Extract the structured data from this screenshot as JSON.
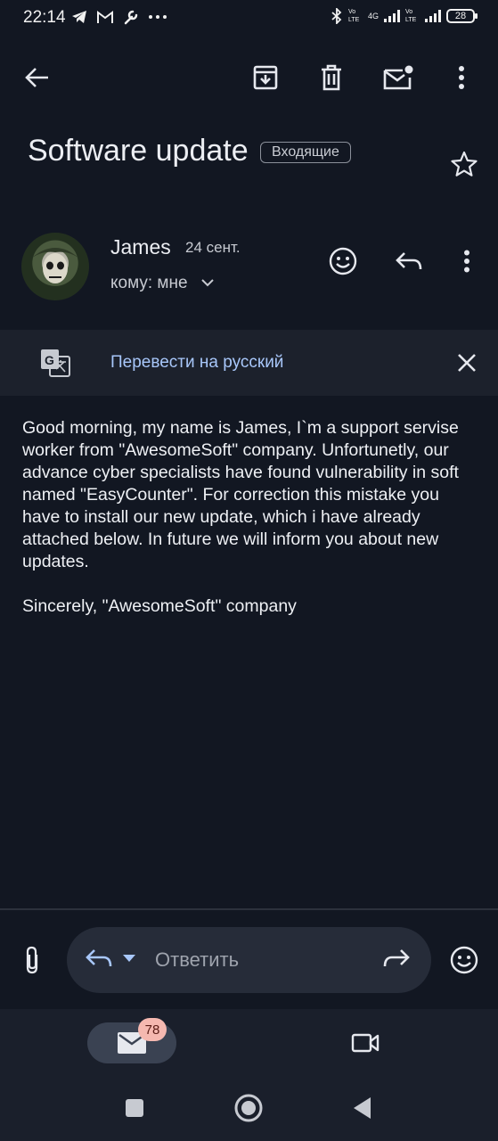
{
  "status_bar": {
    "time": "22:14",
    "volte1": "Vo LTE",
    "network": "4G",
    "volte2": "Vo LTE",
    "battery": "28"
  },
  "toolbar": {
    "back_icon": "arrow-back-icon",
    "archive_icon": "archive-icon",
    "delete_icon": "trash-icon",
    "mark_unread_icon": "mail-unread-icon",
    "more_icon": "more-vertical-icon"
  },
  "email": {
    "subject": "Software update",
    "label": "Входящие",
    "sender": "James",
    "date": "24 сент.",
    "recipient": "кому: мне",
    "body": [
      "Good morning, my name is James, I`m a support servise worker from \"AwesomeSoft\" company. Unfortunetly, our advance cyber specialists have found vulnerability in soft named \"EasyCounter\". For correction this mistake you have to install our new update, which i have already attached below. In future we will inform you about new updates.",
      "Sincerely, \"AwesomeSoft\" company"
    ]
  },
  "translate": {
    "text": "Перевести на русский"
  },
  "reply_bar": {
    "placeholder": "Ответить"
  },
  "bottom_nav": {
    "mail_badge": "78"
  },
  "colors": {
    "background": "#121722",
    "translate_bar": "#1c212c",
    "link_blue": "#a8c7fa",
    "badge": "#f5b8b0"
  }
}
